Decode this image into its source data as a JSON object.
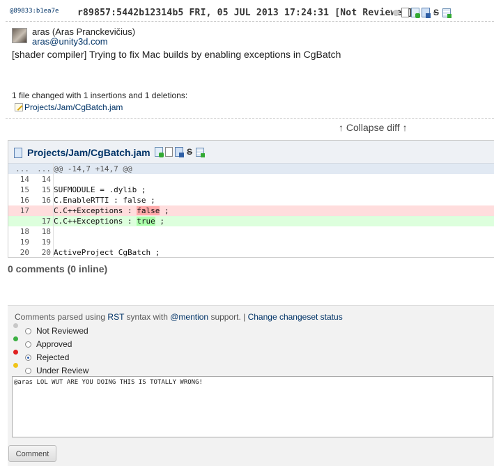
{
  "header": {
    "short_rev": "@89833:b1ea7e",
    "full_rev": "r89857:5442b12314b5 FRI, 05 JUL 2013 17:24:31",
    "status": "[Not Reviewed]"
  },
  "author": {
    "name": "aras (Aras Pranckevičius)",
    "email": "aras@unity3d.com"
  },
  "commit_message": "[shader compiler] Trying to fix Mac builds by enabling exceptions in CgBatch",
  "summary": "1 file changed with 1 insertions and 1 deletions:",
  "changed_file": "Projects/Jam/CgBatch.jam",
  "collapse_label": "↑ Collapse diff ↑",
  "diff": {
    "file": "Projects/Jam/CgBatch.jam",
    "hunk": {
      "old": "...",
      "new": "...",
      "text": "@@ -14,7 +14,7 @@"
    },
    "lines": [
      {
        "old": "14",
        "new": "14",
        "pre": "",
        "hl": "",
        "post": "",
        "type": "ctx"
      },
      {
        "old": "15",
        "new": "15",
        "pre": "SUFMODULE = .dylib ;",
        "hl": "",
        "post": "",
        "type": "ctx"
      },
      {
        "old": "16",
        "new": "16",
        "pre": "C.EnableRTTI : false ;",
        "hl": "",
        "post": "",
        "type": "ctx"
      },
      {
        "old": "17",
        "new": "",
        "pre": "C.C++Exceptions : ",
        "hl": "false",
        "post": " ;",
        "type": "del"
      },
      {
        "old": "",
        "new": "17",
        "pre": "C.C++Exceptions : ",
        "hl": "true",
        "post": " ;",
        "type": "add"
      },
      {
        "old": "18",
        "new": "18",
        "pre": "",
        "hl": "",
        "post": "",
        "type": "ctx"
      },
      {
        "old": "19",
        "new": "19",
        "pre": "",
        "hl": "",
        "post": "",
        "type": "ctx"
      },
      {
        "old": "20",
        "new": "20",
        "pre": "ActiveProject CgBatch ;",
        "hl": "",
        "post": "",
        "type": "ctx"
      }
    ]
  },
  "comments_count": "0 comments (0 inline)",
  "form": {
    "note_prefix": "Comments parsed using ",
    "rst_link": "RST",
    "note_middle": " syntax with ",
    "mention_link": "@mention",
    "note_suffix": " support. | ",
    "status_link": "Change changeset status",
    "statuses": [
      {
        "label": "Not Reviewed",
        "color": "#c8c8c8",
        "selected": false
      },
      {
        "label": "Approved",
        "color": "#3cb043",
        "selected": false
      },
      {
        "label": "Rejected",
        "color": "#e02020",
        "selected": true
      },
      {
        "label": "Under Review",
        "color": "#f0c419",
        "selected": false
      }
    ],
    "comment_text": "@aras LOL WUT ARE YOU DOING THIS IS TOTALLY WRONG!",
    "submit_label": "Comment"
  }
}
